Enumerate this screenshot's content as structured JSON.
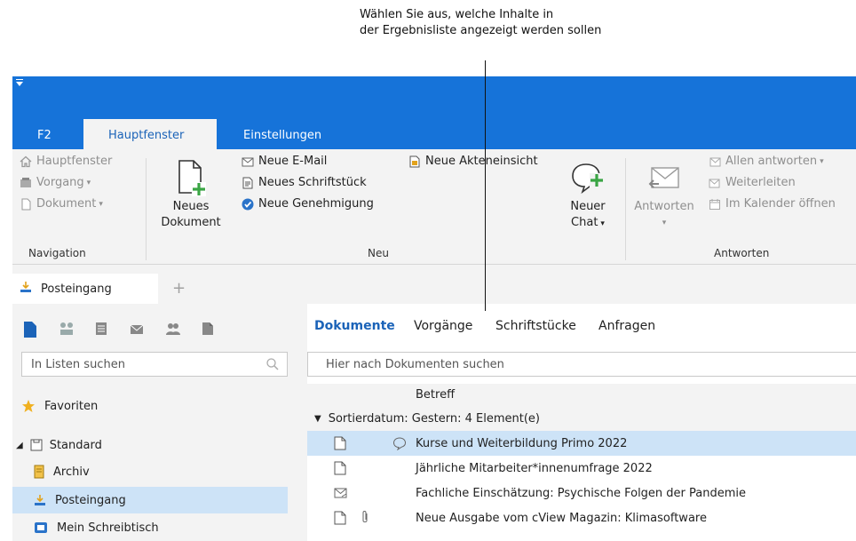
{
  "callout": {
    "line1": "Wählen Sie aus, welche Inhalte in",
    "line2": "der Ergebnisliste angezeigt werden sollen"
  },
  "ribbon_tabs": [
    {
      "label": "F2"
    },
    {
      "label": "Hauptfenster"
    },
    {
      "label": "Einstellungen"
    }
  ],
  "ribbon": {
    "navigation": {
      "hauptfenster": "Hauptfenster",
      "vorgang": "Vorgang",
      "dokument": "Dokument",
      "group_label": "Navigation"
    },
    "neu": {
      "neues_dokument_l1": "Neues",
      "neues_dokument_l2": "Dokument",
      "neue_email": "Neue E-Mail",
      "neues_schriftstueck": "Neues Schriftstück",
      "neue_genehmigung": "Neue Genehmigung",
      "neue_akteneinsicht": "Neue Akteneinsicht",
      "neuer_chat_l1": "Neuer",
      "neuer_chat_l2": "Chat",
      "group_label": "Neu"
    },
    "antworten": {
      "antworten": "Antworten",
      "allen_antworten": "Allen antworten",
      "weiterleiten": "Weiterleiten",
      "kalender": "Im Kalender öffnen",
      "group_label": "Antworten"
    }
  },
  "doc_tab": {
    "label": "Posteingang",
    "add": "+"
  },
  "left": {
    "search_placeholder": "In Listen suchen",
    "favoriten": "Favoriten",
    "standard": "Standard",
    "items": [
      {
        "label": "Archiv"
      },
      {
        "label": "Posteingang"
      },
      {
        "label": "Mein Schreibtisch"
      }
    ]
  },
  "right": {
    "tabs": [
      {
        "label": "Dokumente"
      },
      {
        "label": "Vorgänge"
      },
      {
        "label": "Schriftstücke"
      },
      {
        "label": "Anfragen"
      }
    ],
    "search_placeholder": "Hier nach Dokumenten suchen",
    "column_header": "Betreff",
    "group_label": "Sortierdatum: Gestern: 4 Element(e)",
    "rows": [
      {
        "subject": "Kurse und Weiterbildung Primo 2022"
      },
      {
        "subject": "Jährliche Mitarbeiter*innenumfrage 2022"
      },
      {
        "subject": "Fachliche Einschätzung: Psychische Folgen der Pandemie"
      },
      {
        "subject": "Neue Ausgabe vom cView Magazin: Klimasoftware"
      }
    ]
  },
  "colors": {
    "accent": "#1673d9",
    "selection": "#cde3f7",
    "ribbon_bg": "#f3f3f3"
  }
}
